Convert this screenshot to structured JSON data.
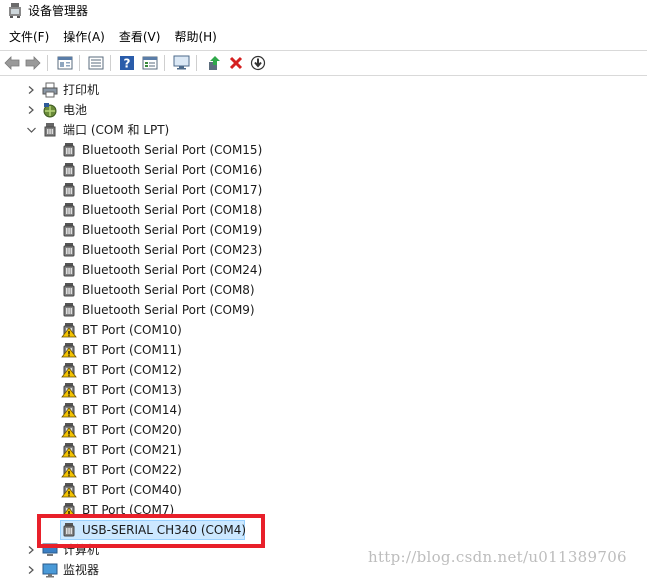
{
  "window": {
    "title": "设备管理器"
  },
  "menu": {
    "items": [
      "文件(F)",
      "操作(A)",
      "查看(V)",
      "帮助(H)"
    ]
  },
  "toolbar": {
    "buttons": [
      {
        "icon": "back-arrow-icon"
      },
      {
        "icon": "forward-arrow-icon"
      },
      {
        "icon": "properties-window-icon"
      },
      {
        "icon": "list-view-icon"
      },
      {
        "icon": "help-icon"
      },
      {
        "icon": "details-view-icon"
      },
      {
        "icon": "monitor-scan-icon"
      },
      {
        "icon": "update-driver-icon"
      },
      {
        "icon": "uninstall-x-icon"
      },
      {
        "icon": "download-circle-icon"
      }
    ]
  },
  "tree": {
    "top_categories": [
      {
        "label": "打印机",
        "icon": "printer-icon",
        "expanded": false
      },
      {
        "label": "电池",
        "icon": "battery-icon",
        "expanded": false
      },
      {
        "label": "端口 (COM 和 LPT)",
        "icon": "port-icon",
        "expanded": true
      }
    ],
    "ports": [
      {
        "label": "Bluetooth Serial Port (COM15)",
        "warning": false
      },
      {
        "label": "Bluetooth Serial Port (COM16)",
        "warning": false
      },
      {
        "label": "Bluetooth Serial Port (COM17)",
        "warning": false
      },
      {
        "label": "Bluetooth Serial Port (COM18)",
        "warning": false
      },
      {
        "label": "Bluetooth Serial Port (COM19)",
        "warning": false
      },
      {
        "label": "Bluetooth Serial Port (COM23)",
        "warning": false
      },
      {
        "label": "Bluetooth Serial Port (COM24)",
        "warning": false
      },
      {
        "label": "Bluetooth Serial Port (COM8)",
        "warning": false
      },
      {
        "label": "Bluetooth Serial Port (COM9)",
        "warning": false
      },
      {
        "label": "BT Port (COM10)",
        "warning": true
      },
      {
        "label": "BT Port (COM11)",
        "warning": true
      },
      {
        "label": "BT Port (COM12)",
        "warning": true
      },
      {
        "label": "BT Port (COM13)",
        "warning": true
      },
      {
        "label": "BT Port (COM14)",
        "warning": true
      },
      {
        "label": "BT Port (COM20)",
        "warning": true
      },
      {
        "label": "BT Port (COM21)",
        "warning": true
      },
      {
        "label": "BT Port (COM22)",
        "warning": true
      },
      {
        "label": "BT Port (COM40)",
        "warning": true
      },
      {
        "label": "BT Port (COM7)",
        "warning": true
      },
      {
        "label": "USB-SERIAL CH340 (COM4)",
        "warning": false,
        "selected": true
      }
    ],
    "bottom_categories": [
      {
        "label": "计算机",
        "icon": "computer-icon",
        "expanded": false
      },
      {
        "label": "监视器",
        "icon": "monitor-icon",
        "expanded": false
      }
    ]
  },
  "watermark": "http://blog.csdn.net/u011389706",
  "colors": {
    "selection_bg": "#cce8ff",
    "highlight_border": "#e8202a",
    "warning_yellow": "#f2c200"
  }
}
